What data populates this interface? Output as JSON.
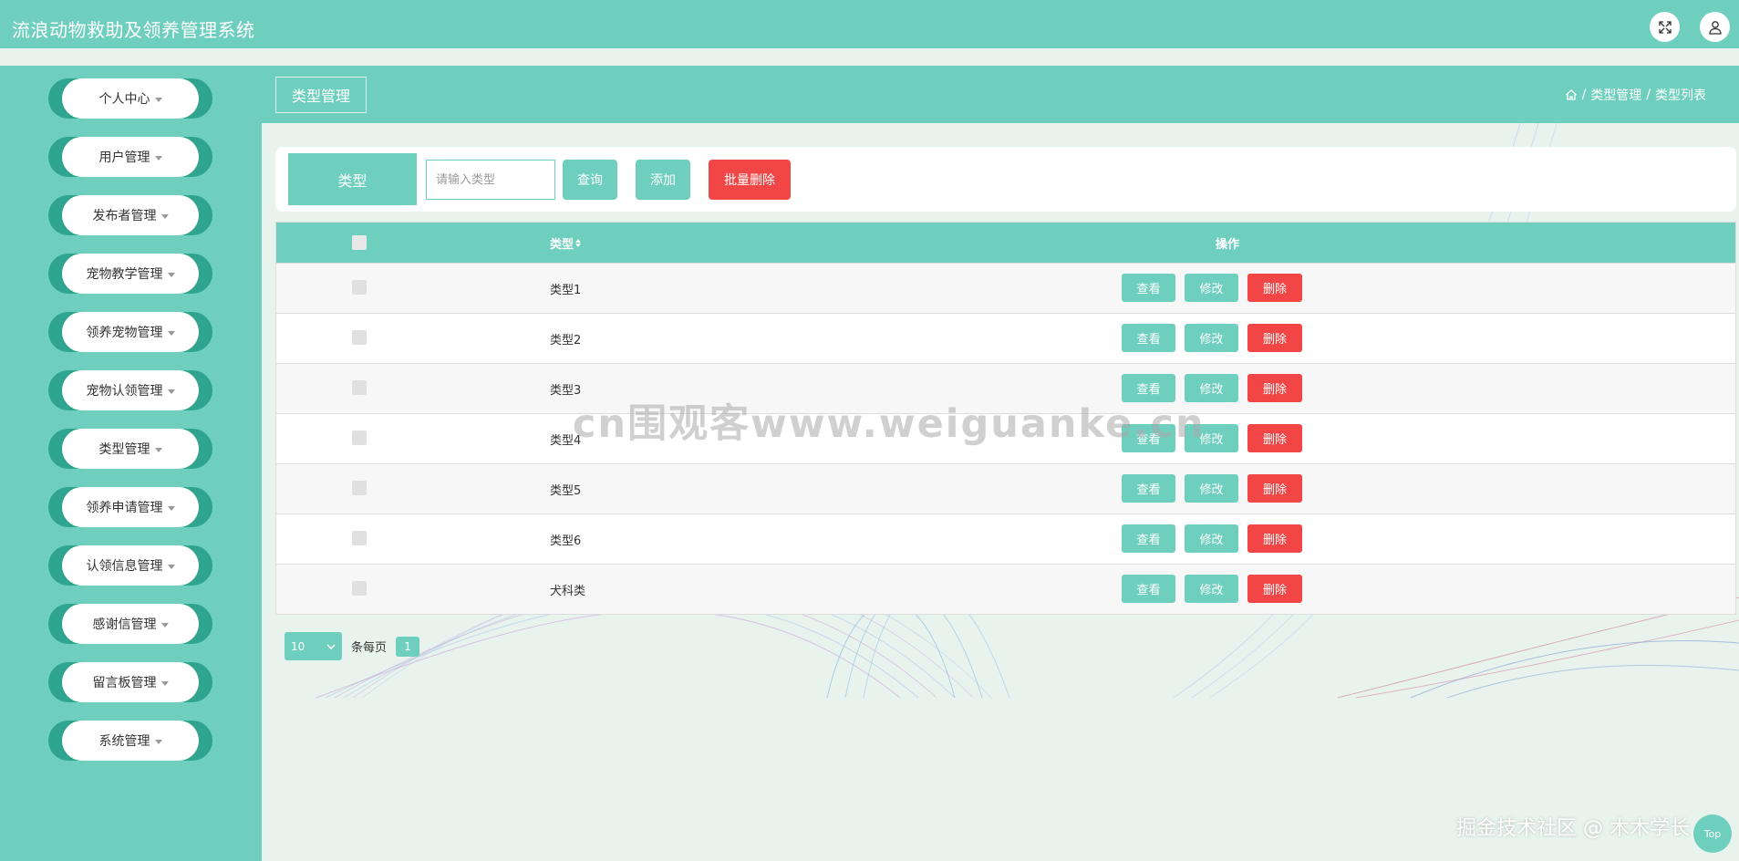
{
  "header": {
    "app_title": "流浪动物救助及领养管理系统",
    "fullscreen_icon": "fullscreen-icon",
    "user_icon": "user-icon"
  },
  "sidebar": {
    "items": [
      {
        "label": "个人中心"
      },
      {
        "label": "用户管理"
      },
      {
        "label": "发布者管理"
      },
      {
        "label": "宠物教学管理"
      },
      {
        "label": "领养宠物管理"
      },
      {
        "label": "宠物认领管理"
      },
      {
        "label": "类型管理"
      },
      {
        "label": "领养申请管理"
      },
      {
        "label": "认领信息管理"
      },
      {
        "label": "感谢信管理"
      },
      {
        "label": "留言板管理"
      },
      {
        "label": "系统管理"
      }
    ]
  },
  "content_header": {
    "tab_label": "类型管理",
    "breadcrumb": {
      "home_icon": "home-icon",
      "sep": "/",
      "level1": "类型管理",
      "level2": "类型列表"
    }
  },
  "search": {
    "label": "类型",
    "placeholder": "请输入类型",
    "value": "",
    "query_button": "查询",
    "add_button": "添加",
    "batch_delete_button": "批量删除"
  },
  "table": {
    "columns": {
      "type": "类型",
      "actions": "操作"
    },
    "rows": [
      {
        "type": "类型1"
      },
      {
        "type": "类型2"
      },
      {
        "type": "类型3"
      },
      {
        "type": "类型4"
      },
      {
        "type": "类型5"
      },
      {
        "type": "类型6"
      },
      {
        "type": "犬科类"
      }
    ],
    "row_actions": {
      "view": "查看",
      "edit": "修改",
      "delete": "删除"
    }
  },
  "pagination": {
    "page_size": "10",
    "per_page_label": "条每页",
    "current_page": "1"
  },
  "overlay": {
    "watermark": "cn围观客www.weiguanke.cn",
    "credit": "掘金技术社区 @ 木木学长",
    "top_button": "Top"
  },
  "colors": {
    "primary": "#6fcfbf",
    "sidebar_pill_shadow": "#2fa48e",
    "danger": "#f24545",
    "page_bg": "#e9f3ee"
  }
}
